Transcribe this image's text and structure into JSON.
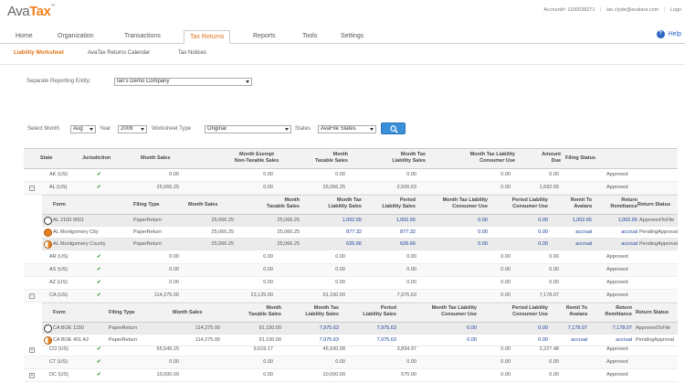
{
  "header": {
    "logo": {
      "ava": "Ava",
      "tax": "Tax"
    },
    "account": "Account#: 1100038271",
    "sep": "|",
    "user": "ian.clyde@avalara.com",
    "logout": "Logo"
  },
  "nav": {
    "tabs": [
      {
        "label": "Home"
      },
      {
        "label": "Organization"
      },
      {
        "label": "Transactions"
      },
      {
        "label": "Tax Returns"
      },
      {
        "label": "Reports"
      },
      {
        "label": "Tools"
      },
      {
        "label": "Settings"
      }
    ],
    "active_tab": "Tax Returns",
    "help": "Help"
  },
  "subnav": {
    "items": [
      {
        "label": "Liability Worksheet"
      },
      {
        "label": "AvaTax Returns Calendar"
      },
      {
        "label": "Tax Notices"
      }
    ],
    "active": "Liability Worksheet"
  },
  "entity": {
    "label": "Separate Reporting Entity:",
    "value": "Ian's Demo Company"
  },
  "filters": {
    "month_label": "Select Month",
    "month": "Aug",
    "year_label": "Year",
    "year": "2009",
    "type_label": "Worksheet Type",
    "type": "Original",
    "states_label": "States",
    "states": "AvaFile States"
  },
  "table": {
    "headers": [
      "State",
      "Jurisdiction",
      "Month Sales",
      "Month Exempt\nNon-Taxable Sales",
      "Month\nTaxable Sales",
      "Month Tax\nLiability Sales",
      "Month Tax Liability\nConsumer Use",
      "Amount\nDue",
      "Filing Status"
    ],
    "sub_headers": [
      "Form",
      "Filing Type",
      "Month Sales",
      "Month\nTaxable Sales",
      "Month Tax\nLiability Sales",
      "Period\nLiability Sales",
      "Month Tax Liability\nConsumer Use",
      "Period Liability\nConsumer Use",
      "Remit To\nAvalara",
      "Return\nRemittance",
      "Return Status"
    ],
    "rows_top": [
      {
        "state": "AK (US)",
        "exp": "",
        "check": "✔",
        "sales": "0.00",
        "exempt": "0.00",
        "taxable": "0.00",
        "liability": "0.00",
        "consumer": "0.00",
        "due": "0.00",
        "status": "Approved"
      },
      {
        "state": "AL (US)",
        "exp": "−",
        "check": "✔",
        "sales": "25,066.25",
        "exempt": "0.00",
        "taxable": "25,066.25",
        "liability": "2,506.63",
        "consumer": "0.00",
        "due": "1,692.65",
        "status": "Approved"
      }
    ],
    "al_forms": [
      {
        "form": "AL 2100 9501",
        "type": "PaperReturn",
        "sales": "25,066.25",
        "taxable": "25,066.25",
        "liab": "1,002.65",
        "period": "1,002.65",
        "cons": "0.00",
        "pcons": "0.00",
        "remit": "1,002.65",
        "ret": "1,002.65",
        "status": "ApprovedToFile",
        "icon": "clock"
      },
      {
        "form": "AL Montgomery City",
        "type": "PaperReturn",
        "sales": "25,066.25",
        "taxable": "25,066.25",
        "liab": "877.32",
        "period": "877.32",
        "cons": "0.00",
        "pcons": "0.00",
        "remit": "accrual",
        "ret": "accrual",
        "status": "PendingApproval",
        "icon": "orange"
      },
      {
        "form": "AL Montgomery County",
        "type": "PaperReturn",
        "sales": "25,066.25",
        "taxable": "25,066.25",
        "liab": "626.66",
        "period": "626.66",
        "cons": "0.00",
        "pcons": "0.00",
        "remit": "accrual",
        "ret": "accrual",
        "status": "PendingApproval",
        "icon": "half"
      }
    ],
    "rows_mid": [
      {
        "state": "AR (US)",
        "exp": "",
        "check": "✔",
        "sales": "0.00",
        "exempt": "0.00",
        "taxable": "0.00",
        "liability": "0.00",
        "consumer": "0.00",
        "due": "0.00",
        "status": "Approved"
      },
      {
        "state": "AS (US)",
        "exp": "",
        "check": "✔",
        "sales": "0.00",
        "exempt": "0.00",
        "taxable": "0.00",
        "liability": "0.00",
        "consumer": "0.00",
        "due": "0.00",
        "status": "Approved"
      },
      {
        "state": "AZ (US)",
        "exp": "",
        "check": "✔",
        "sales": "0.00",
        "exempt": "0.00",
        "taxable": "0.00",
        "liability": "0.00",
        "consumer": "0.00",
        "due": "0.00",
        "status": "Approved"
      },
      {
        "state": "CA (US)",
        "exp": "−",
        "check": "✔",
        "sales": "114,275.00",
        "exempt": "23,125.00",
        "taxable": "91,150.00",
        "liability": "7,975.63",
        "consumer": "0.00",
        "due": "7,178.07",
        "status": "Approved"
      }
    ],
    "ca_forms": [
      {
        "form": "CA BOE 1150",
        "type": "PaperReturn",
        "sales": "114,275.00",
        "taxable": "91,150.00",
        "liab": "7,975.63",
        "period": "7,975.63",
        "cons": "0.00",
        "pcons": "0.00",
        "remit": "7,178.07",
        "ret": "7,178.07",
        "status": "ApprovedToFile",
        "icon": "clock"
      },
      {
        "form": "CA BOE 401 A2",
        "type": "PaperReturn",
        "sales": "114,275.00",
        "taxable": "91,150.00",
        "liab": "7,975.63",
        "period": "7,975.63",
        "cons": "0.00",
        "pcons": "0.00",
        "remit": "accrual",
        "ret": "accrual",
        "status": "PendingApproval",
        "icon": "half"
      }
    ],
    "rows_bottom": [
      {
        "state": "CO (US)",
        "exp": "+",
        "check": "✔",
        "sales": "55,549.25",
        "exempt": "9,619.17",
        "taxable": "45,930.08",
        "liability": "3,834.97",
        "consumer": "0.00",
        "due": "2,227.48",
        "status": "Approved"
      },
      {
        "state": "CT (US)",
        "exp": "",
        "check": "✔",
        "sales": "0.00",
        "exempt": "0.00",
        "taxable": "0.00",
        "liability": "0.00",
        "consumer": "0.00",
        "due": "0.00",
        "status": "Approved"
      },
      {
        "state": "DC (US)",
        "exp": "+",
        "check": "✔",
        "sales": "10,000.00",
        "exempt": "0.00",
        "taxable": "10,000.00",
        "liability": "575.00",
        "consumer": "0.00",
        "due": "0.00",
        "status": "Approved"
      }
    ]
  }
}
